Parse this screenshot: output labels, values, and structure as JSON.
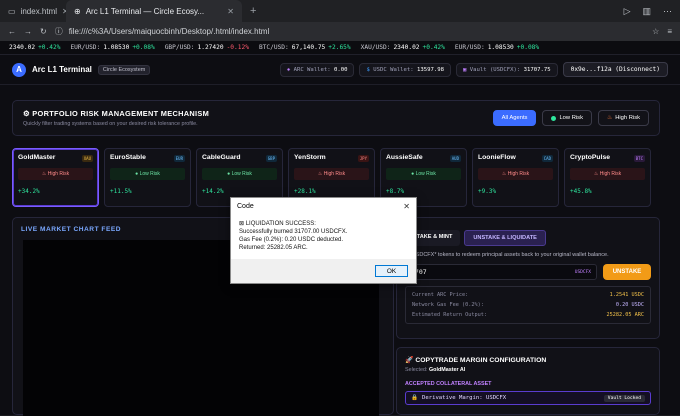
{
  "browser": {
    "tabs": [
      {
        "label": "index.html"
      },
      {
        "label": "Arc L1 Terminal — Circle Ecosy..."
      }
    ],
    "url": "file:///c%3A/Users/maiquocbinh/Desktop/.html/index.html"
  },
  "ticker": [
    {
      "label": "",
      "value": "2340.02",
      "change": "+0.42%",
      "dir": "up"
    },
    {
      "label": "EUR/USD:",
      "value": "1.08530",
      "change": "+0.08%",
      "dir": "up"
    },
    {
      "label": "GBP/USD:",
      "value": "1.27420",
      "change": "-0.12%",
      "dir": "down"
    },
    {
      "label": "BTC/USD:",
      "value": "67,140.75",
      "change": "+2.65%",
      "dir": "up"
    },
    {
      "label": "XAU/USD:",
      "value": "2340.02",
      "change": "+0.42%",
      "dir": "up"
    },
    {
      "label": "EUR/USD:",
      "value": "1.08530",
      "change": "+0.08%",
      "dir": "up"
    }
  ],
  "header": {
    "logo_letter": "A",
    "brand": "Arc L1 Terminal",
    "ecosystem": "Circle Ecosystem",
    "arc_wallet_label": "ARC Wallet:",
    "arc_wallet_value": "0.00",
    "usdc_wallet_label": "USDC Wallet:",
    "usdc_wallet_value": "13597.98",
    "vault_label": "Vault (USDCFX):",
    "vault_value": "31707.75",
    "disconnect": "0x9e...f12a (Disconnect)"
  },
  "risk": {
    "title": "PORTFOLIO RISK MANAGEMENT MECHANISM",
    "subtitle": "Quickly filter trading systems based on your desired risk tolerance profile.",
    "buttons": {
      "all": "All Agents",
      "low": "Low Risk",
      "high": "High Risk"
    }
  },
  "agents": [
    {
      "name": "GoldMaster",
      "tag": "XAU",
      "risk": "High Risk",
      "pct": "+34.2%"
    },
    {
      "name": "EuroStable",
      "tag": "EUR",
      "risk": "Low Risk",
      "pct": "+11.5%"
    },
    {
      "name": "CableGuard",
      "tag": "GBP",
      "risk": "Low Risk",
      "pct": "+14.2%"
    },
    {
      "name": "YenStorm",
      "tag": "JPY",
      "risk": "High Risk",
      "pct": "+28.1%"
    },
    {
      "name": "AussieSafe",
      "tag": "AUD",
      "risk": "Low Risk",
      "pct": "+8.7%"
    },
    {
      "name": "LoonieFlow",
      "tag": "CAD",
      "risk": "High Risk",
      "pct": "+9.3%"
    },
    {
      "name": "CryptoPulse",
      "tag": "BTC",
      "risk": "High Risk",
      "pct": "+45.8%"
    }
  ],
  "chart_panel": {
    "title": "LIVE MARKET CHART FEED"
  },
  "unstake": {
    "tab_stake": "STAKE & MINT",
    "tab_unstake": "UNSTAKE & LIQUIDATE",
    "desc": "n *USDCFX* tokens to redeem principal assets back to your original wallet balance.",
    "amount": "1707",
    "unit": "USDCFX",
    "button": "UNSTAKE",
    "rows": [
      {
        "label": "Current ARC Price:",
        "value": "1.2541 USDC"
      },
      {
        "label": "Network Gas Fee (0.2%):",
        "value": "0.20 USDC"
      },
      {
        "label": "Estimated Return Output:",
        "value": "25282.05 ARC"
      }
    ]
  },
  "copytrade": {
    "title": "COPYTRADE MARGIN CONFIGURATION",
    "selected_label": "Selected:",
    "selected_value": "GoldMaster AI",
    "accepted": "ACCEPTED COLLATERAL ASSET",
    "margin": "Derivative Margin: USDCFX",
    "badge": "Vault Locked"
  },
  "dialog": {
    "title": "Code",
    "line1": "LIQUIDATION SUCCESS:",
    "line2": "Successfully burned 31707.00 USDCFX.",
    "line3": "Gas Fee (0.2%): 0.20 USDC deducted.",
    "line4": "Returned: 25282.05 ARC.",
    "ok": "OK"
  },
  "colors": {
    "accent": "#3b6cff",
    "positive": "#2ee59d",
    "negative": "#ff5a6e",
    "orange": "#f29b17",
    "purple": "#7a5cff"
  }
}
